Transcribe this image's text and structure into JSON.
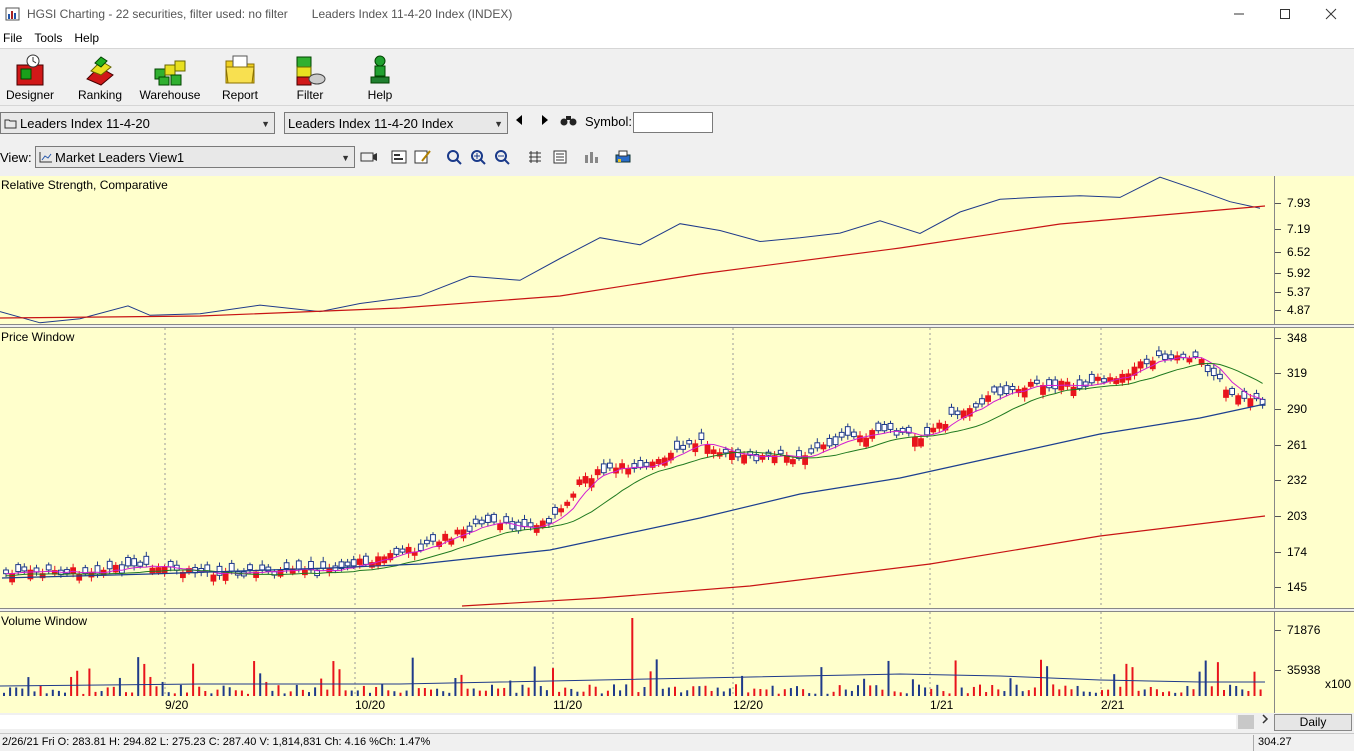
{
  "window": {
    "title": "HGSI Charting - 22 securities, filter used: no filter",
    "subtitle": "Leaders Index 11-4-20 Index (INDEX)"
  },
  "menu": [
    "File",
    "Tools",
    "Help"
  ],
  "toolbar": {
    "designer": "Designer",
    "ranking": "Ranking",
    "warehouse": "Warehouse",
    "report": "Report",
    "filter": "Filter",
    "help": "Help"
  },
  "selectors": {
    "list": "Leaders Index 11-4-20",
    "security": "Leaders Index 11-4-20 Index",
    "symbol_label": "Symbol:",
    "symbol_value": "",
    "view_label": "View:",
    "view_value": "Market Leaders View1"
  },
  "panels": {
    "rs_title": "Relative Strength, Comparative",
    "rs_ticks": [
      "7.93",
      "7.19",
      "6.52",
      "5.92",
      "5.37",
      "4.87"
    ],
    "price_title": "Price Window",
    "price_ticks": [
      "348",
      "319",
      "290",
      "261",
      "232",
      "203",
      "174",
      "145"
    ],
    "volume_title": "Volume Window",
    "volume_ticks": [
      "71876",
      "35938"
    ],
    "volume_unit": "x100",
    "dates": [
      "9/20",
      "10/20",
      "11/20",
      "12/20",
      "1/21",
      "2/21"
    ]
  },
  "period": "Daily",
  "status": {
    "text": "2/26/21 Fri O: 283.81 H: 294.82 L: 275.23 C: 287.40 V: 1,814,831 Ch: 4.16 %Ch: 1.47%",
    "last": "304.27"
  },
  "colors": {
    "chart_bg": "#ffffcc",
    "up": "#1f3a8a",
    "down": "#e8141c",
    "ma_fast": "#d21dd2",
    "ma_mid": "#207a20",
    "ma_slow": "#1c3f8f",
    "ma_long": "#c81414"
  }
}
